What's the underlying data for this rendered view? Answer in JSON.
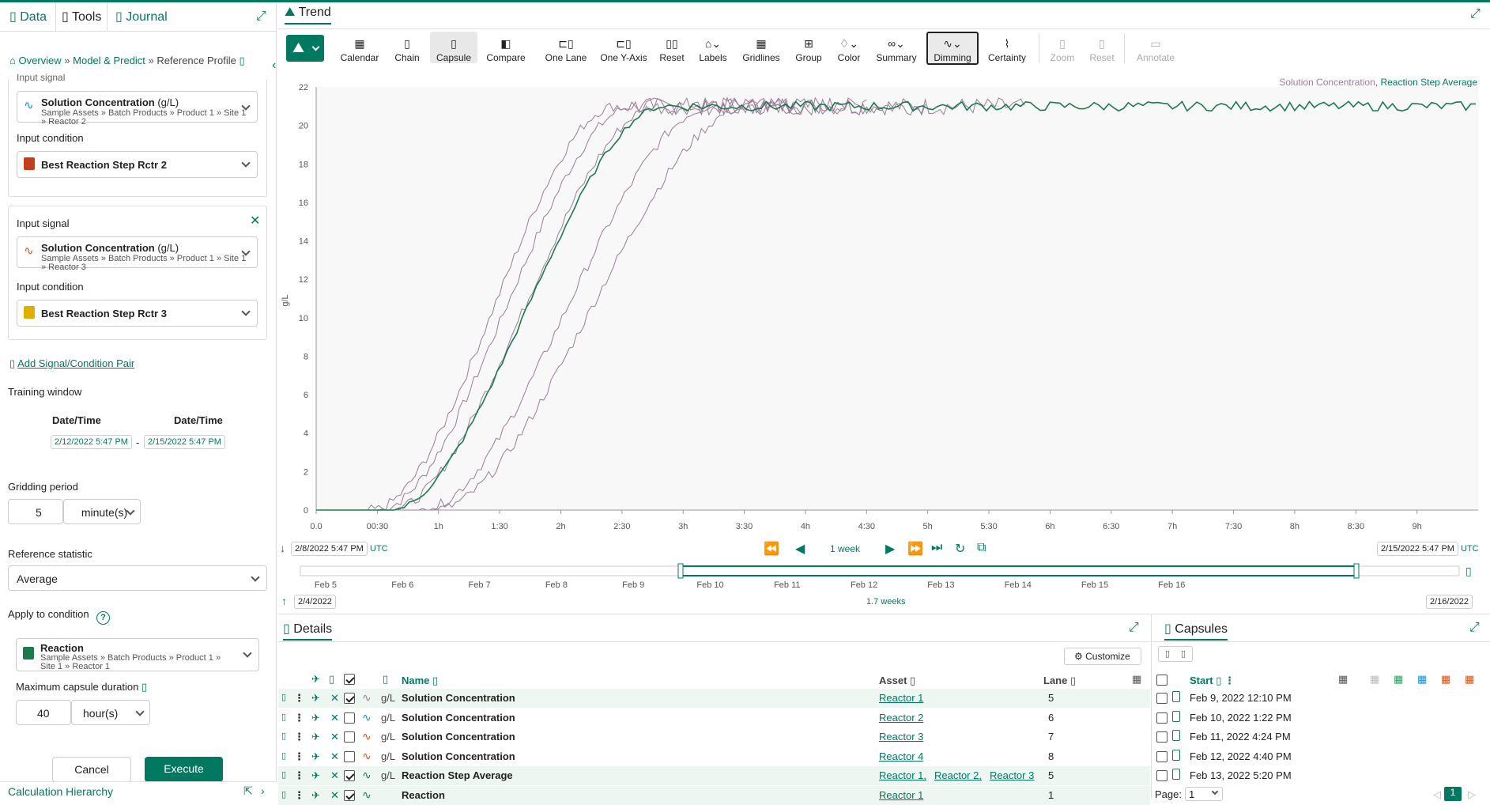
{
  "left": {
    "tabs": [
      "Data",
      "Tools",
      "Journal"
    ],
    "breadcrumb": {
      "overview": "Overview",
      "model": "Model & Predict",
      "sep": "»",
      "current": "Reference Profile"
    },
    "cut_label": "Input signal",
    "pairs": [
      {
        "signal_label": "Input signal",
        "signal_name": "Solution Concentration",
        "signal_unit": "(g/L)",
        "signal_path": "Sample Assets » Batch Products » Product 1 » Site 1 » Reactor 2",
        "condition_label": "Input condition",
        "condition_name": "Best Reaction Step Rctr 2"
      },
      {
        "signal_label": "Input signal",
        "signal_name": "Solution Concentration",
        "signal_unit": "(g/L)",
        "signal_path": "Sample Assets » Batch Products » Product 1 » Site 1 » Reactor 3",
        "condition_label": "Input condition",
        "condition_name": "Best Reaction Step Rctr 3"
      }
    ],
    "add_pair": "Add Signal/Condition Pair",
    "training_window": {
      "label": "Training window",
      "col1": "Date/Time",
      "col2": "Date/Time",
      "start": "2/12/2022 5:47 PM",
      "dash": "-",
      "end": "2/15/2022 5:47 PM"
    },
    "gridding": {
      "label": "Gridding period",
      "value": "5",
      "unit": "minute(s)"
    },
    "reference_statistic": {
      "label": "Reference statistic",
      "value": "Average"
    },
    "apply": {
      "label": "Apply to condition",
      "help": "?",
      "name": "Reaction",
      "path": "Sample Assets » Batch Products » Product 1 » Site 1 » Reactor 1"
    },
    "max_duration": {
      "label": "Maximum capsule duration",
      "value": "40",
      "unit": "hour(s)"
    },
    "cancel": "Cancel",
    "execute": "Execute",
    "calc_hierarchy": "Calculation Hierarchy"
  },
  "trend": {
    "tab": "Trend",
    "toolbar": [
      "Calendar",
      "Chain",
      "Capsule",
      "Compare",
      "One Lane",
      "One Y-Axis",
      "Reset",
      "Labels",
      "Gridlines",
      "Group",
      "Color",
      "Summary",
      "Dimming",
      "Certainty",
      "Zoom",
      "Reset",
      "Annotate"
    ],
    "legend": {
      "a": "Solution Concentration",
      "sep": ",",
      "b": "Reaction Step Average"
    },
    "ylabel": "g/L",
    "start_time": "2/8/2022 5:47 PM",
    "end_time": "2/15/2022 5:47 PM",
    "tz": "UTC",
    "period": "1 week",
    "nav_start": "2/4/2022",
    "nav_end": "2/16/2022",
    "nav_span": "1.7 weeks",
    "nav_ticks": [
      "Feb 5",
      "Feb 6",
      "Feb 7",
      "Feb 8",
      "Feb 9",
      "Feb 10",
      "Feb 11",
      "Feb 12",
      "Feb 13",
      "Feb 14",
      "Feb 15",
      "Feb 16"
    ]
  },
  "chart_data": {
    "type": "line",
    "ylabel": "g/L",
    "ylim": [
      0,
      22
    ],
    "yticks": [
      0,
      2,
      4,
      6,
      8,
      10,
      12,
      14,
      16,
      18,
      20,
      22
    ],
    "xlim_hours": [
      0,
      9.5
    ],
    "xticks": [
      "0.0",
      "00:30",
      "1h",
      "1:30",
      "2h",
      "2:30",
      "3h",
      "3:30",
      "4h",
      "4:30",
      "5h",
      "5:30",
      "6h",
      "6:30",
      "7h",
      "7:30",
      "8h",
      "8:30",
      "9h"
    ],
    "series": [
      {
        "name": "Solution Concentration",
        "color": "#9a7b99",
        "start": 0.5,
        "rise": 2.1,
        "plateau": 21.0,
        "end": 5.8
      },
      {
        "name": "Solution Concentration",
        "color": "#9a7b99",
        "start": 0.45,
        "rise": 2.0,
        "plateau": 21.0,
        "end": 5.0
      },
      {
        "name": "Solution Concentration",
        "color": "#9a7b99",
        "start": 0.6,
        "rise": 2.2,
        "plateau": 21.0,
        "end": 4.5
      },
      {
        "name": "Solution Concentration",
        "color": "#9a7b99",
        "start": 0.85,
        "rise": 2.4,
        "plateau": 21.0,
        "end": 4.0
      },
      {
        "name": "Solution Concentration",
        "color": "#9a7b99",
        "start": 0.95,
        "rise": 2.6,
        "plateau": 21.0,
        "end": 3.9
      },
      {
        "name": "Reaction Step Average",
        "color": "#1d7a4c",
        "start": 0.6,
        "rise": 2.25,
        "plateau": 21.0,
        "end": 9.5
      }
    ]
  },
  "details": {
    "tab": "Details",
    "customize": "Customize",
    "headers": {
      "name": "Name",
      "asset": "Asset",
      "lane": "Lane"
    },
    "rows": [
      {
        "unit": "g/L",
        "name": "Solution Concentration",
        "assets": [
          "Reactor 1"
        ],
        "lane": "5",
        "checked": true,
        "color": "#9a7b99"
      },
      {
        "unit": "g/L",
        "name": "Solution Concentration",
        "assets": [
          "Reactor 2"
        ],
        "lane": "6",
        "checked": false,
        "color": "#1a8fd0"
      },
      {
        "unit": "g/L",
        "name": "Solution Concentration",
        "assets": [
          "Reactor 3"
        ],
        "lane": "7",
        "checked": false,
        "color": "#d2531b"
      },
      {
        "unit": "g/L",
        "name": "Solution Concentration",
        "assets": [
          "Reactor 4"
        ],
        "lane": "8",
        "checked": false,
        "color": "#d2531b"
      },
      {
        "unit": "g/L",
        "name": "Reaction Step Average",
        "assets": [
          "Reactor 1,",
          "Reactor 2,",
          "Reactor 3"
        ],
        "lane": "5",
        "checked": true,
        "color": "#1d7a4c"
      },
      {
        "unit": "",
        "name": "Reaction",
        "assets": [
          "Reactor 1"
        ],
        "lane": "1",
        "checked": true,
        "color": "#1d7a4c"
      }
    ]
  },
  "capsules": {
    "tab": "Capsules",
    "header": "Start",
    "rows": [
      "Feb 9, 2022 12:10 PM",
      "Feb 10, 2022 1:22 PM",
      "Feb 11, 2022 4:24 PM",
      "Feb 12, 2022 4:40 PM",
      "Feb 13, 2022 5:20 PM"
    ],
    "page_label": "Page:",
    "page_value": "1",
    "current_page": "1"
  }
}
